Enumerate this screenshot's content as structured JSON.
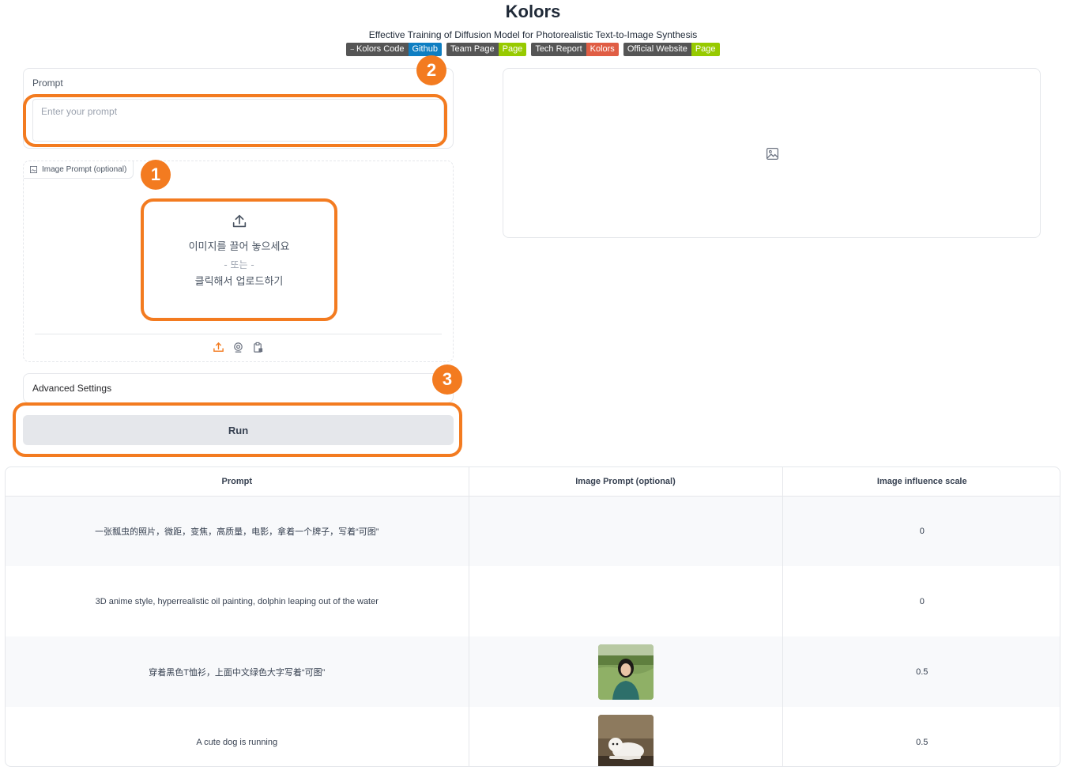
{
  "header": {
    "title": "Kolors",
    "subtitle": "Effective Training of Diffusion Model for Photorealistic Text-to-Image Synthesis",
    "badges": [
      {
        "left": "Kolors Code",
        "right": "Github",
        "right_color": "#0e7ec2"
      },
      {
        "left": "Team Page",
        "right": "Page",
        "right_color": "#97ca00"
      },
      {
        "left": "Tech Report",
        "right": "Kolors",
        "right_color": "#e05d44"
      },
      {
        "left": "Official Website",
        "right": "Page",
        "right_color": "#97ca00"
      }
    ]
  },
  "prompt": {
    "label": "Prompt",
    "placeholder": "Enter your prompt"
  },
  "image_prompt": {
    "label": "Image Prompt (optional)",
    "drop_text": "이미지를 끌어 놓으세요",
    "or_text": "- 또는 -",
    "click_text": "클릭해서 업로드하기",
    "source_icons": [
      "upload-icon",
      "webcam-icon",
      "clipboard-icon"
    ]
  },
  "advanced": {
    "label": "Advanced Settings"
  },
  "run_button": {
    "label": "Run"
  },
  "callouts": {
    "one": "1",
    "two": "2",
    "three": "3",
    "color": "#f37b20"
  },
  "examples": {
    "headers": [
      "Prompt",
      "Image Prompt (optional)",
      "Image influence scale"
    ],
    "rows": [
      {
        "prompt": "一张瓢虫的照片，微距，变焦，高质量，电影，拿着一个牌子，写着“可图”",
        "image": "",
        "scale": "0"
      },
      {
        "prompt": "3D anime style, hyperrealistic oil painting, dolphin leaping out of the water",
        "image": "",
        "scale": "0"
      },
      {
        "prompt": "穿着黑色T恤衫，上面中文绿色大字写着“可图”",
        "image": "woman-in-field-thumbnail",
        "scale": "0.5"
      },
      {
        "prompt": "A cute dog is running",
        "image": "white-dog-thumbnail",
        "scale": "0.5"
      }
    ]
  }
}
